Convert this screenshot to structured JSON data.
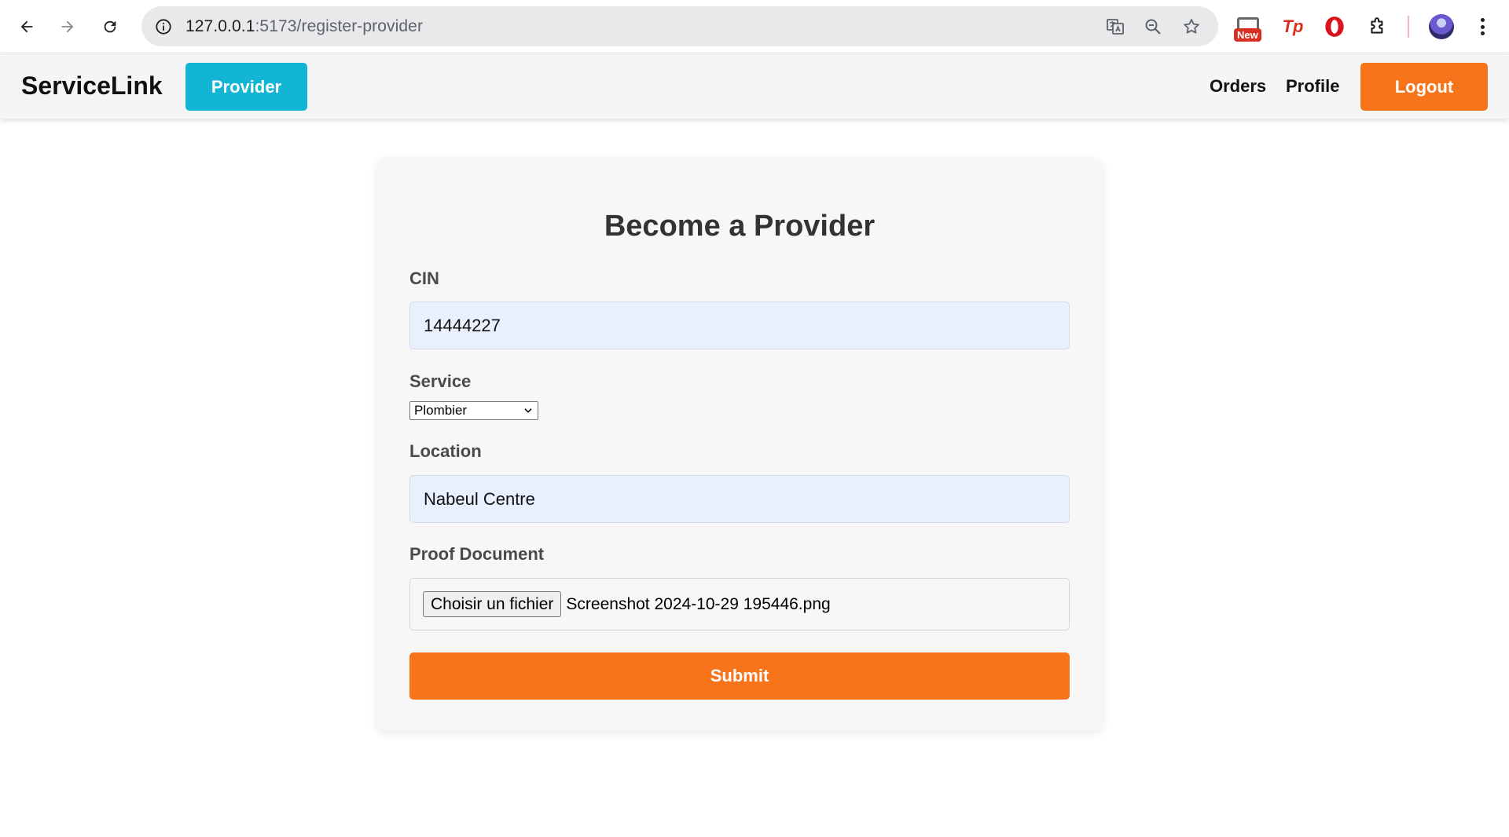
{
  "browser": {
    "url_host": "127.0.0.1",
    "url_path": ":5173/register-provider",
    "extension_badge": "New",
    "extension_tp": "Tp",
    "icons": [
      "back-icon",
      "forward-icon",
      "reload-icon",
      "site-info-icon",
      "translate-icon",
      "zoom-icon",
      "bookmark-star-icon",
      "extensions-puzzle-icon",
      "profile-avatar",
      "menu-kebab-icon"
    ]
  },
  "header": {
    "brand": "ServiceLink",
    "role_button": "Provider",
    "nav": [
      "Orders",
      "Profile"
    ],
    "logout": "Logout"
  },
  "form": {
    "title": "Become a Provider",
    "cin_label": "CIN",
    "cin_value": "14444227",
    "service_label": "Service",
    "service_value": "Plombier",
    "location_label": "Location",
    "location_value": "Nabeul Centre",
    "proof_label": "Proof Document",
    "file_button": "Choisir un fichier",
    "file_name": "Screenshot 2024-10-29 195446.png",
    "submit": "Submit"
  },
  "colors": {
    "accent_cyan": "#12b5d4",
    "accent_orange": "#f7741b",
    "input_fill": "#e8effd"
  }
}
